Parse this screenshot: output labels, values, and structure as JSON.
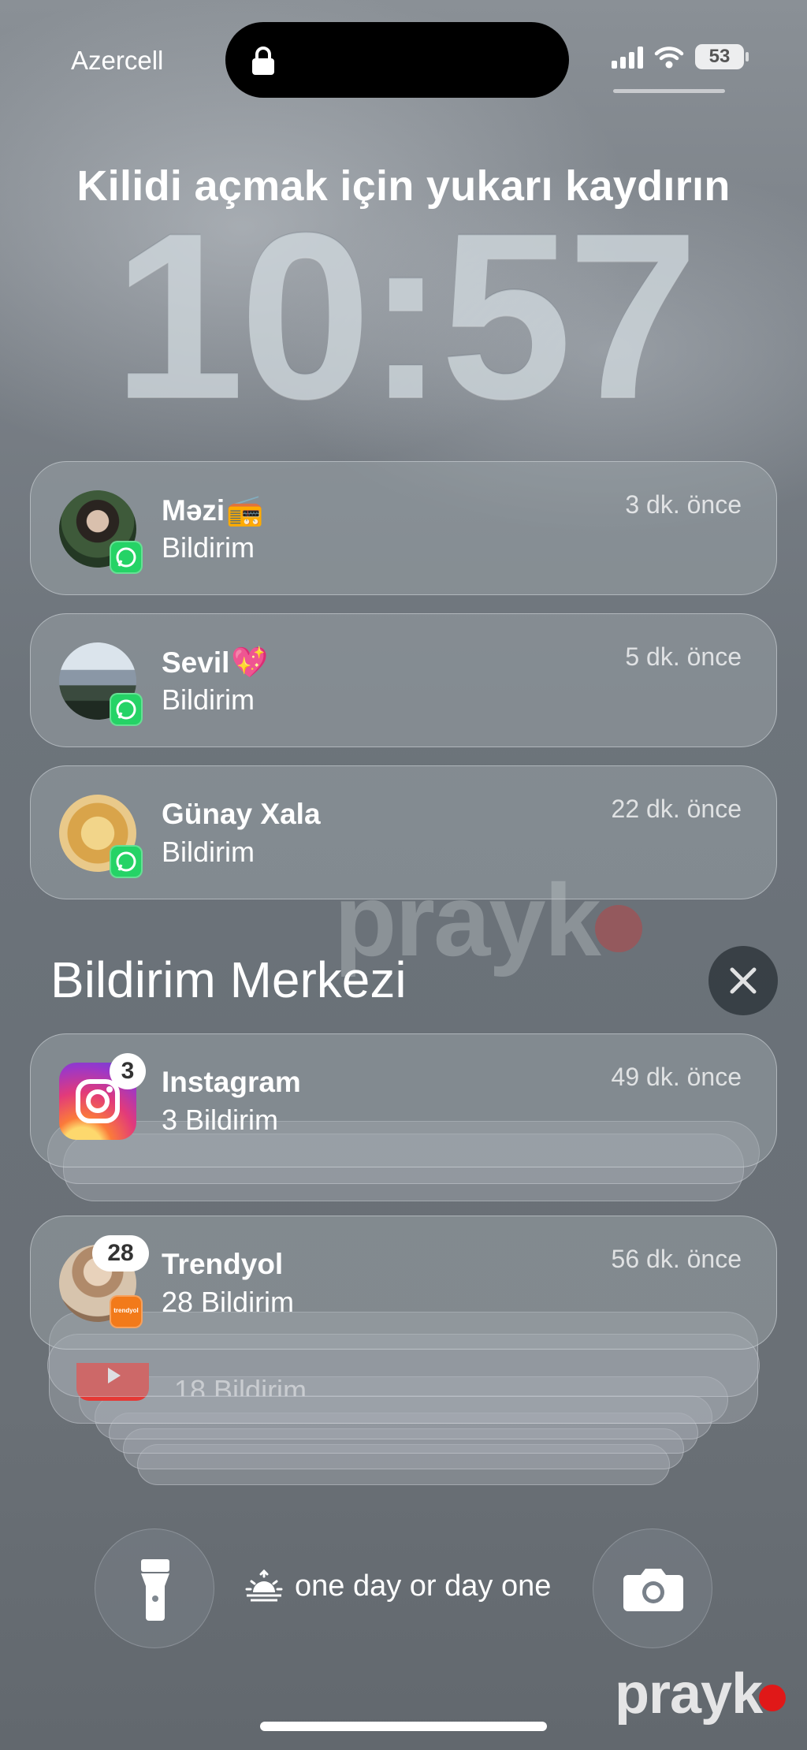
{
  "status_bar": {
    "carrier": "Azercell",
    "battery": "53",
    "icons": [
      "signal-icon",
      "wifi-icon",
      "battery-icon",
      "lock-icon"
    ]
  },
  "lock_screen": {
    "unlock_hint": "Kilidi açmak için yukarı kaydırın",
    "time": "10:57"
  },
  "notifications": [
    {
      "sender": "Məzi",
      "emoji": "📻",
      "body": "Bildirim",
      "time": "3 dk. önce",
      "app_icon": "whatsapp-icon"
    },
    {
      "sender": "Sevil",
      "emoji": "💖",
      "body": "Bildirim",
      "time": "5 dk. önce",
      "app_icon": "whatsapp-icon"
    },
    {
      "sender": "Günay Xala",
      "emoji": "",
      "body": "Bildirim",
      "time": "22 dk. önce",
      "app_icon": "whatsapp-icon"
    }
  ],
  "notification_center": {
    "title": "Bildirim Merkezi",
    "close_icon": "close-icon",
    "groups": [
      {
        "app": "Instagram",
        "body": "3 Bildirim",
        "time": "49 dk. önce",
        "count": "3"
      },
      {
        "app": "Trendyol",
        "body": "28 Bildirim",
        "time": "56 dk. önce",
        "count": "28",
        "badge_label": "trendyol"
      }
    ],
    "hidden_partial": {
      "body": "18 Bildirim"
    }
  },
  "bottom": {
    "focus_label": "one day or day one",
    "flashlight_icon": "flashlight-icon",
    "camera_icon": "camera-icon"
  },
  "watermark": {
    "text": "prayk"
  },
  "colors": {
    "whatsapp": "#25D366",
    "trendyol": "#F27A1A",
    "youtube": "#E53935",
    "watermark_dot": "#E01818"
  }
}
